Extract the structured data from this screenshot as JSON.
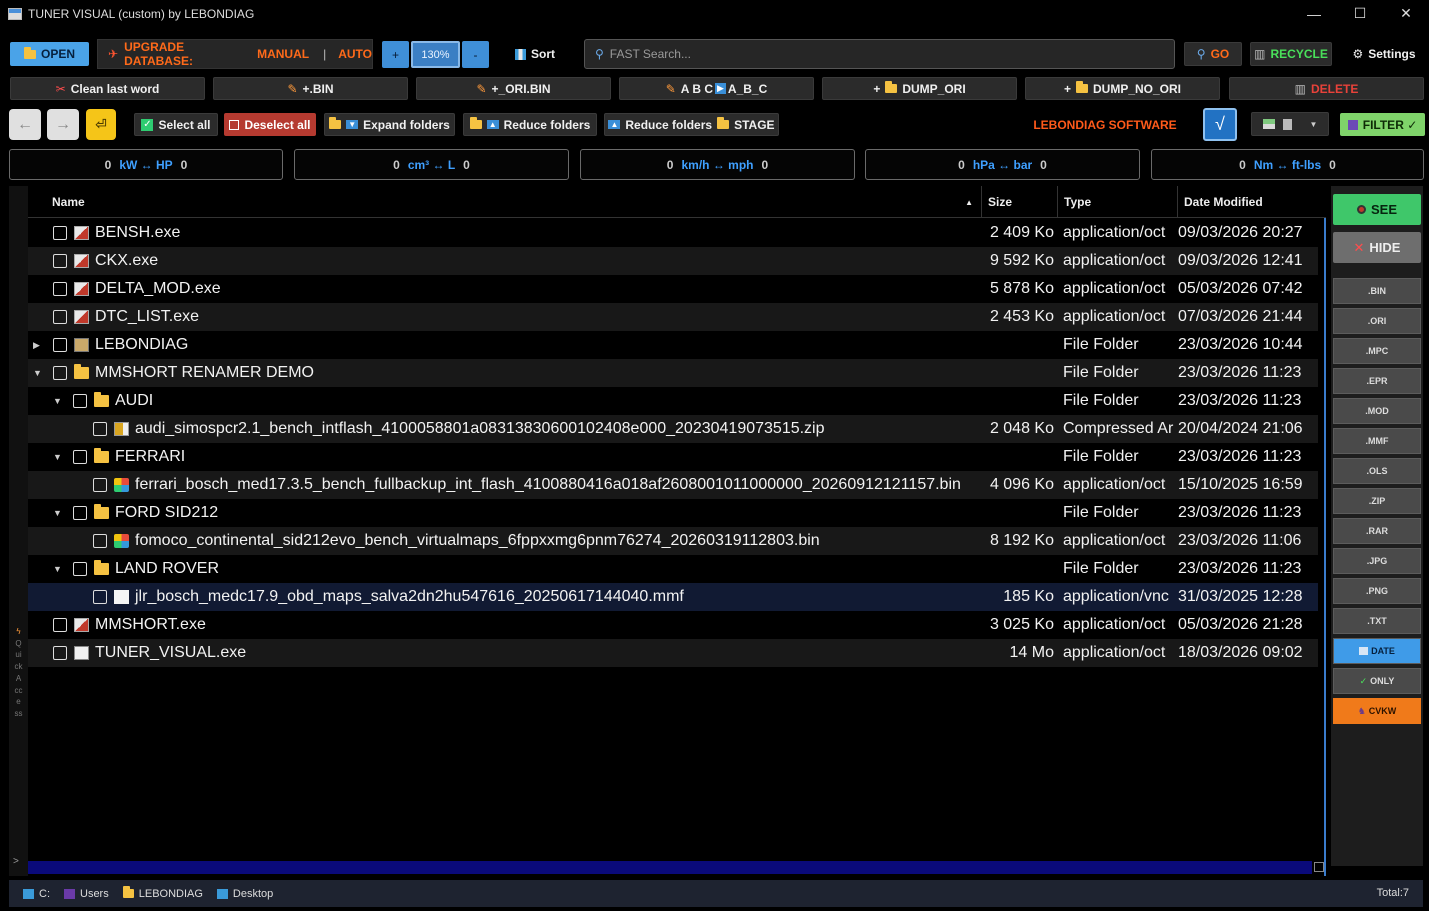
{
  "window": {
    "title": "TUNER VISUAL (custom) by LEBONDIAG",
    "minimize": "—",
    "maximize": "☐",
    "close": "✕"
  },
  "toolbar": {
    "open": "OPEN",
    "upgrade_label": "UPGRADE DATABASE:",
    "manual": "MANUAL",
    "separator": "|",
    "auto": "AUTO",
    "zoom_plus": "+",
    "zoom_level": "130%",
    "zoom_minus": "-",
    "sort": "Sort",
    "search_placeholder": "FAST Search...",
    "go": "GO",
    "recycle": "RECYCLE",
    "settings": "Settings"
  },
  "actions": {
    "clean_last_word": "Clean last word",
    "bin": "+.BIN",
    "ori_bin": "+_ORI.BIN",
    "abc_prefix": "A B C",
    "abc_suffix": "A_B_C",
    "dump_ori": "DUMP_ORI",
    "dump_no_ori": "DUMP_NO_ORI",
    "delete": "DELETE"
  },
  "nav": {
    "back": "←",
    "forward": "→",
    "select_all": "Select all",
    "deselect_all": "Deselect all",
    "expand_folders": "Expand folders",
    "reduce_folders": "Reduce folders",
    "reduce_folders_stage": "Reduce folders",
    "stage": "STAGE",
    "brand": "LEBONDIAG SOFTWARE",
    "check": "√",
    "filter": "FILTER ✓"
  },
  "converters": [
    {
      "left": "0",
      "unit": "kW ↔ HP",
      "right": "0"
    },
    {
      "left": "0",
      "unit": "cm³ ↔ L",
      "right": "0"
    },
    {
      "left": "0",
      "unit": "km/h ↔ mph",
      "right": "0"
    },
    {
      "left": "0",
      "unit": "hPa ↔ bar",
      "right": "0"
    },
    {
      "left": "0",
      "unit": "Nm ↔ ft-lbs",
      "right": "0"
    }
  ],
  "quick_access": "Quick Access",
  "columns": {
    "name": "Name",
    "sort_indicator": "▲",
    "size": "Size",
    "type": "Type",
    "date": "Date Modified"
  },
  "rows": [
    {
      "name": "BENSH.exe",
      "size": "2 409 Ko",
      "type": "application/oct",
      "date": "09/03/2026 20:27"
    },
    {
      "name": "CKX.exe",
      "size": "9 592 Ko",
      "type": "application/oct",
      "date": "09/03/2026 12:41"
    },
    {
      "name": "DELTA_MOD.exe",
      "size": "5 878 Ko",
      "type": "application/oct",
      "date": "05/03/2026 07:42"
    },
    {
      "name": "DTC_LIST.exe",
      "size": "2 453 Ko",
      "type": "application/oct",
      "date": "07/03/2026 21:44"
    },
    {
      "name": "LEBONDIAG",
      "size": "",
      "type": "File Folder",
      "date": "23/03/2026 10:44"
    },
    {
      "name": "MMSHORT RENAMER DEMO",
      "size": "",
      "type": "File Folder",
      "date": "23/03/2026 11:23"
    },
    {
      "name": "AUDI",
      "size": "",
      "type": "File Folder",
      "date": "23/03/2026 11:23"
    },
    {
      "name": "audi_simospcr2.1_bench_intflash_4100058801a08313830600102408e000_20230419073515.zip",
      "size": "2 048 Ko",
      "type": "Compressed Ar",
      "date": "20/04/2024 21:06"
    },
    {
      "name": "FERRARI",
      "size": "",
      "type": "File Folder",
      "date": "23/03/2026 11:23"
    },
    {
      "name": "ferrari_bosch_med17.3.5_bench_fullbackup_int_flash_4100880416a018af2608001011000000_20260912121157.bin",
      "size": "4 096 Ko",
      "type": "application/oct",
      "date": "15/10/2025 16:59"
    },
    {
      "name": "FORD SID212",
      "size": "",
      "type": "File Folder",
      "date": "23/03/2026 11:23"
    },
    {
      "name": "fomoco_continental_sid212evo_bench_virtualmaps_6fppxxmg6pnm76274_20260319112803.bin",
      "size": "8 192 Ko",
      "type": "application/oct",
      "date": "23/03/2026 11:06"
    },
    {
      "name": "LAND ROVER",
      "size": "",
      "type": "File Folder",
      "date": "23/03/2026 11:23"
    },
    {
      "name": "jlr_bosch_medc17.9_obd_maps_salva2dn2hu547616_20250617144040.mmf",
      "size": "185 Ko",
      "type": "application/vnc",
      "date": "31/03/2025 12:28"
    },
    {
      "name": "MMSHORT.exe",
      "size": "3 025 Ko",
      "type": "application/oct",
      "date": "05/03/2026 21:28"
    },
    {
      "name": "TUNER_VISUAL.exe",
      "size": "14 Mo",
      "type": "application/oct",
      "date": "18/03/2026 09:02"
    }
  ],
  "expand_arrows": {
    "collapsed": "▶",
    "expanded": "▼"
  },
  "right_panel": {
    "see": "SEE",
    "hide": "HIDE",
    "filters": [
      ".BIN",
      ".ORI",
      ".MPC",
      ".EPR",
      ".MOD",
      ".MMF",
      ".OLS",
      ".ZIP",
      ".RAR",
      ".JPG",
      ".PNG",
      ".TXT"
    ],
    "date": "DATE",
    "only": "ONLY",
    "cvkw": "CVKW"
  },
  "left_gutter_arrow": ">",
  "status": {
    "crumbs": [
      "C:",
      "Users",
      "LEBONDIAG",
      "Desktop"
    ],
    "total": "Total:7"
  }
}
